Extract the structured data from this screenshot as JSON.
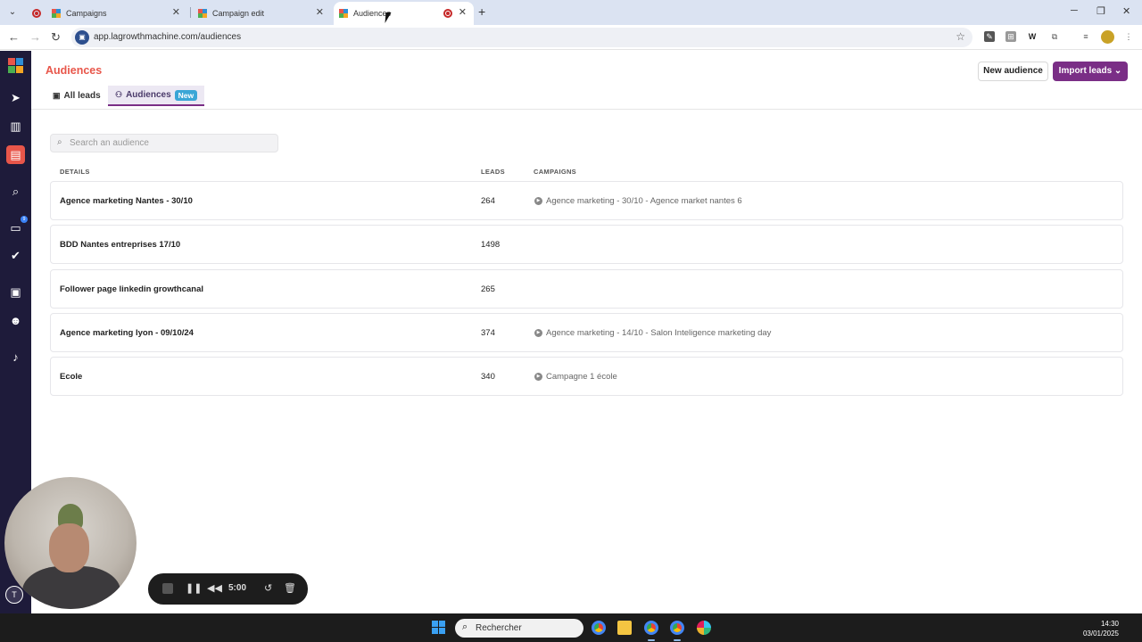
{
  "browser": {
    "tabs": [
      {
        "label": "Campaigns"
      },
      {
        "label": "Campaign edit"
      },
      {
        "label": "Audiences"
      }
    ],
    "url": "app.lagrowthmachine.com/audiences",
    "icons": {
      "back": "arrow-left-icon",
      "forward": "arrow-right-icon",
      "reload": "reload-icon",
      "star": "star-icon",
      "new_tab": "plus-icon"
    }
  },
  "app": {
    "brand_colors": {
      "accent": "#e8564a",
      "primary": "#7a2e86",
      "sidebar": "#1e1b3a",
      "badge": "#3aa6d6"
    },
    "sidebar": {
      "items": [
        {
          "icon": "send-icon"
        },
        {
          "icon": "chart-icon"
        },
        {
          "icon": "contacts-icon",
          "active": true
        },
        {
          "icon": "search-icon"
        },
        {
          "icon": "inbox-icon",
          "badge": "9"
        },
        {
          "icon": "check-icon"
        },
        {
          "icon": "robot-icon"
        },
        {
          "icon": "team-icon"
        },
        {
          "icon": "bell-icon"
        }
      ],
      "user_initial": "T"
    },
    "header": {
      "title": "Audiences",
      "new_audience_label": "New audience",
      "import_leads_label": "Import leads"
    },
    "subtabs": [
      {
        "label": "All leads"
      },
      {
        "label": "Audiences",
        "badge": "New"
      }
    ],
    "search": {
      "placeholder": "Search an audience",
      "value": ""
    },
    "table": {
      "columns": [
        "DETAILS",
        "LEADS",
        "CAMPAIGNS"
      ],
      "rows": [
        {
          "name": "Agence marketing Nantes - 30/10",
          "leads": "264",
          "campaign": "Agence marketing - 30/10 - Agence market nantes 6"
        },
        {
          "name": "BDD Nantes entreprises 17/10",
          "leads": "1498",
          "campaign": ""
        },
        {
          "name": "Follower page linkedin growthcanal",
          "leads": "265",
          "campaign": ""
        },
        {
          "name": "Agence marketing lyon - 09/10/24",
          "leads": "374",
          "campaign": "Agence marketing - 14/10 - Salon Inteligence marketing day"
        },
        {
          "name": "Ecole",
          "leads": "340",
          "campaign": "Campagne 1 école"
        }
      ]
    }
  },
  "recorder": {
    "time": "5:00"
  },
  "taskbar": {
    "search_label": "Rechercher",
    "time": "14:30",
    "date": "03/01/2025"
  }
}
